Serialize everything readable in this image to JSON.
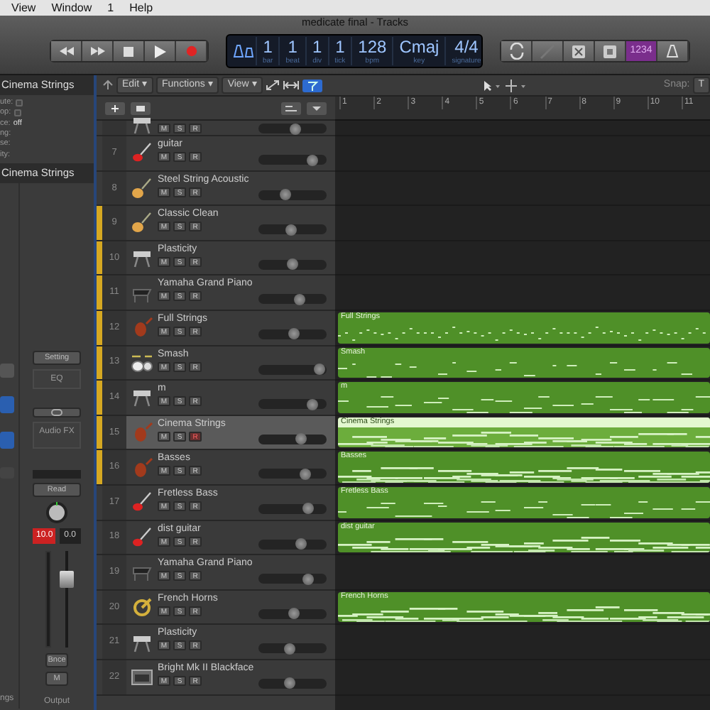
{
  "menu": [
    {
      "label": "View"
    },
    {
      "label": "Window"
    },
    {
      "label": "1"
    },
    {
      "label": "Help"
    }
  ],
  "window": {
    "title": "medicate final - Tracks"
  },
  "lcd": [
    {
      "value": "1",
      "label": "bar"
    },
    {
      "value": "1",
      "label": "beat"
    },
    {
      "value": "1",
      "label": "div"
    },
    {
      "value": "1",
      "label": "tick"
    },
    {
      "value": "128",
      "label": "bpm"
    },
    {
      "value": "Cmaj",
      "label": "key"
    },
    {
      "value": "4/4",
      "label": "signature"
    }
  ],
  "count_in": {
    "label": "1234",
    "on": true
  },
  "toolbar": {
    "menus": [
      "Edit ▾",
      "Functions ▾",
      "View ▾"
    ],
    "snap_label": "Snap:",
    "snap_value": "T"
  },
  "inspector": {
    "region_header": "Cinema Strings",
    "params": [
      {
        "label": "ute:",
        "kind": "checkbox",
        "checked": false
      },
      {
        "label": "op:",
        "kind": "checkbox",
        "checked": false
      },
      {
        "label": "ce:",
        "value": "off",
        "kind": "popup"
      },
      {
        "label": "ng:",
        "kind": "text"
      },
      {
        "label": "se:",
        "kind": "popup"
      },
      {
        "label": "ity:",
        "kind": "text"
      }
    ],
    "track_header": "Cinema Strings"
  },
  "channel_strip": {
    "setting": "Setting",
    "eq": "EQ",
    "audio_fx": "Audio FX",
    "automation": "Read",
    "volume": "10.0",
    "pan": "0.0",
    "output": "Bnce",
    "mute": "M",
    "name": "Output",
    "left_label": "ngs",
    "fader": {
      "level": 0.75
    }
  },
  "ruler": [
    "1",
    "2",
    "3",
    "4",
    "5",
    "6",
    "7",
    "8",
    "9",
    "10",
    "11"
  ],
  "tracks": [
    {
      "kind": "synth",
      "buttons": [
        "M",
        "S",
        "R"
      ],
      "selected": false,
      "record": false,
      "level": 0.55
    },
    {
      "number": "7",
      "name": "guitar",
      "kind": "electric-guitar",
      "buttons": [
        "M",
        "S",
        "R"
      ],
      "selected": false,
      "record": false,
      "level": 0.8
    },
    {
      "number": "8",
      "name": "Steel String Acoustic",
      "kind": "acoustic-guitar",
      "buttons": [
        "M",
        "S",
        "R"
      ],
      "selected": false,
      "record": false,
      "level": 0.4
    },
    {
      "number": "9",
      "name": "Classic Clean",
      "kind": "acoustic-guitar",
      "buttons": [
        "M",
        "S",
        "R"
      ],
      "selected": false,
      "record": false,
      "level": 0.47,
      "color": "#d6a822"
    },
    {
      "number": "10",
      "name": "Plasticity",
      "kind": "synth",
      "buttons": [
        "M",
        "S",
        "R"
      ],
      "selected": false,
      "record": false,
      "level": 0.5,
      "color": "#d6a822"
    },
    {
      "number": "11",
      "name": "Yamaha Grand Piano",
      "kind": "piano",
      "buttons": [
        "M",
        "S",
        "R"
      ],
      "selected": false,
      "record": false,
      "level": 0.6,
      "color": "#d6a822"
    },
    {
      "number": "12",
      "name": "Full Strings",
      "kind": "violin",
      "buttons": [
        "M",
        "S",
        "R"
      ],
      "selected": false,
      "record": false,
      "level": 0.52,
      "color": "#d6a822",
      "region": {
        "name": "Full Strings",
        "selected": false
      }
    },
    {
      "number": "13",
      "name": "Smash",
      "kind": "drums",
      "buttons": [
        "M",
        "S",
        "R"
      ],
      "selected": false,
      "record": false,
      "level": 0.9,
      "color": "#d6a822",
      "region": {
        "name": "Smash",
        "selected": false
      }
    },
    {
      "number": "14",
      "name": "m",
      "kind": "synth",
      "buttons": [
        "M",
        "S",
        "R"
      ],
      "selected": false,
      "record": false,
      "level": 0.8,
      "color": "#d6a822",
      "region": {
        "name": "m",
        "selected": false
      }
    },
    {
      "number": "15",
      "name": "Cinema Strings",
      "kind": "violin",
      "buttons": [
        "M",
        "S",
        "R"
      ],
      "selected": true,
      "record": true,
      "level": 0.62,
      "color": "#d6a822",
      "region": {
        "name": "Cinema Strings",
        "selected": true
      }
    },
    {
      "number": "16",
      "name": "Basses",
      "kind": "violin",
      "buttons": [
        "M",
        "S",
        "R"
      ],
      "selected": false,
      "record": false,
      "level": 0.68,
      "color": "#d6a822",
      "region": {
        "name": "Basses",
        "selected": false
      }
    },
    {
      "number": "17",
      "name": "Fretless Bass",
      "kind": "electric-guitar",
      "buttons": [
        "M",
        "S",
        "R"
      ],
      "selected": false,
      "record": false,
      "level": 0.73,
      "region": {
        "name": "Fretless Bass",
        "selected": false
      }
    },
    {
      "number": "18",
      "name": "dist guitar",
      "kind": "electric-guitar",
      "buttons": [
        "M",
        "S",
        "R"
      ],
      "selected": false,
      "record": false,
      "level": 0.62,
      "region": {
        "name": "dist guitar",
        "selected": false
      }
    },
    {
      "number": "19",
      "name": "Yamaha Grand Piano",
      "kind": "piano",
      "buttons": [
        "M",
        "S",
        "R"
      ],
      "selected": false,
      "record": false,
      "level": 0.73
    },
    {
      "number": "20",
      "name": "French Horns",
      "kind": "horn",
      "buttons": [
        "M",
        "S",
        "R"
      ],
      "selected": false,
      "record": false,
      "level": 0.52,
      "region": {
        "name": "French Horns",
        "selected": false
      }
    },
    {
      "number": "21",
      "name": "Plasticity",
      "kind": "synth",
      "buttons": [
        "M",
        "S",
        "R"
      ],
      "selected": false,
      "record": false,
      "level": 0.45
    },
    {
      "number": "22",
      "name": "Bright Mk II Blackface",
      "kind": "amp",
      "buttons": [
        "M",
        "S",
        "R"
      ],
      "selected": false,
      "record": false,
      "level": 0.45
    }
  ]
}
